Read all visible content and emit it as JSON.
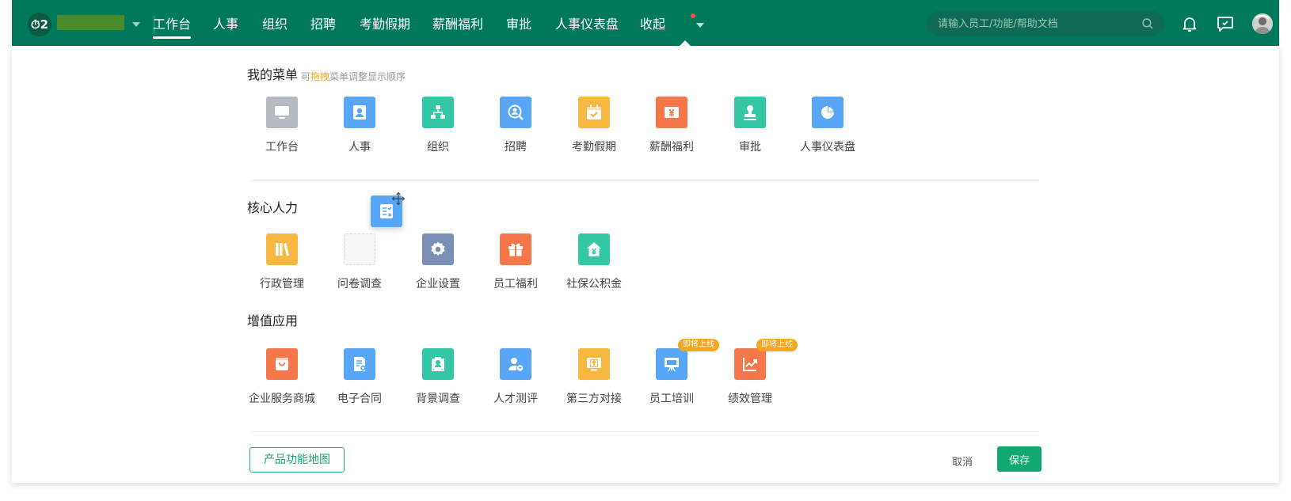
{
  "colors": {
    "topbar": "#00795a",
    "accent": "#12a86f",
    "badge": "#f5a623",
    "hint_highlight": "#f5a623"
  },
  "topbar": {
    "logo_text": "⏱2",
    "nav": [
      {
        "label": "工作台",
        "active": true
      },
      {
        "label": "人事"
      },
      {
        "label": "组织"
      },
      {
        "label": "招聘"
      },
      {
        "label": "考勤假期"
      },
      {
        "label": "薪酬福利"
      },
      {
        "label": "审批"
      },
      {
        "label": "人事仪表盘"
      },
      {
        "label": "收起"
      }
    ],
    "search_placeholder": "请输入员工/功能/帮助文档"
  },
  "my_menu": {
    "title": "我的菜单",
    "hint_prefix": "可",
    "hint_highlight": "拖拽",
    "hint_suffix": "菜单调整显示顺序",
    "items": [
      {
        "label": "工作台",
        "icon": "monitor-icon",
        "color": "#b5bac1"
      },
      {
        "label": "人事",
        "icon": "person-card-icon",
        "color": "#57a6f7"
      },
      {
        "label": "组织",
        "icon": "org-chart-icon",
        "color": "#34c7a5"
      },
      {
        "label": "招聘",
        "icon": "search-person-icon",
        "color": "#57a6f7"
      },
      {
        "label": "考勤假期",
        "icon": "calendar-check-icon",
        "color": "#f8b740"
      },
      {
        "label": "薪酬福利",
        "icon": "yuan-icon",
        "color": "#f6784a"
      },
      {
        "label": "审批",
        "icon": "stamp-icon",
        "color": "#34c7a5"
      },
      {
        "label": "人事仪表盘",
        "icon": "pie-chart-icon",
        "color": "#57a6f7"
      }
    ]
  },
  "core_hr": {
    "title": "核心人力",
    "items": [
      {
        "label": "行政管理",
        "icon": "books-icon",
        "color": "#f8b740"
      },
      {
        "label": "问卷调查",
        "icon": "questionnaire-icon",
        "color": "#57a6f7"
      },
      {
        "label": "企业设置",
        "icon": "gear-icon",
        "color": "#7b8eb8"
      },
      {
        "label": "员工福利",
        "icon": "gift-icon",
        "color": "#f6784a"
      },
      {
        "label": "社保公积金",
        "icon": "house-yuan-icon",
        "color": "#34c7a5"
      }
    ]
  },
  "value_added": {
    "title": "增值应用",
    "items": [
      {
        "label": "企业服务商城",
        "icon": "shopping-bag-icon",
        "color": "#f6784a"
      },
      {
        "label": "电子合同",
        "icon": "contract-icon",
        "color": "#57a6f7"
      },
      {
        "label": "背景调查",
        "icon": "background-check-icon",
        "color": "#34c7a5"
      },
      {
        "label": "人才测评",
        "icon": "talent-assessment-icon",
        "color": "#57a6f7"
      },
      {
        "label": "第三方对接",
        "icon": "integration-icon",
        "color": "#f8b740"
      },
      {
        "label": "员工培训",
        "icon": "presentation-board-icon",
        "color": "#57a6f7",
        "badge": "即将上线"
      },
      {
        "label": "绩效管理",
        "icon": "trend-chart-icon",
        "color": "#f6784a",
        "badge": "即将上线"
      }
    ]
  },
  "footer": {
    "map_button": "产品功能地图",
    "cancel_button": "取消",
    "save_button": "保存"
  }
}
